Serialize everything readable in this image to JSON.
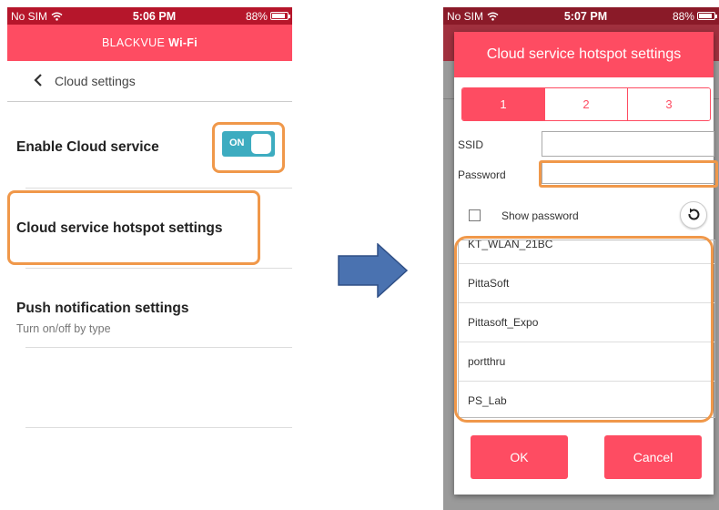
{
  "left": {
    "status": {
      "carrier": "No SIM",
      "time": "5:06 PM",
      "battery": "88%",
      "battery_level": 0.88
    },
    "appbar": {
      "brand": "BLACKVUE",
      "brand_bold": "Wi-Fi"
    },
    "nav": {
      "back_label": "Cloud settings"
    },
    "enable_cloud": {
      "label": "Enable Cloud service",
      "toggle_text": "ON",
      "state": "on"
    },
    "hotspot": {
      "label": "Cloud service hotspot settings"
    },
    "push": {
      "label": "Push notification settings",
      "sub": "Turn on/off by type"
    }
  },
  "right": {
    "status": {
      "carrier": "No SIM",
      "time": "5:07 PM",
      "battery": "88%",
      "battery_level": 0.88
    },
    "dialog": {
      "title": "Cloud service hotspot settings",
      "tabs": [
        "1",
        "2",
        "3"
      ],
      "active_tab": "1",
      "ssid_label": "SSID",
      "ssid_value": "",
      "password_label": "Password",
      "password_value": "",
      "show_password_label": "Show password",
      "networks": [
        "KT_WLAN_21BC",
        "PittaSoft",
        "Pittasoft_Expo",
        "portthru",
        "PS_Lab"
      ],
      "ok_label": "OK",
      "cancel_label": "Cancel"
    }
  },
  "colors": {
    "accent": "#fe4c62",
    "statusbar": "#b6162b",
    "toggle_on": "#3dacc0",
    "highlight": "#f0984a",
    "arrow": "#4a72b0"
  },
  "icons": {
    "back": "chevron-left-icon",
    "wifi": "wifi-icon",
    "battery": "battery-icon",
    "refresh": "refresh-icon",
    "arrow": "right-arrow-icon"
  }
}
